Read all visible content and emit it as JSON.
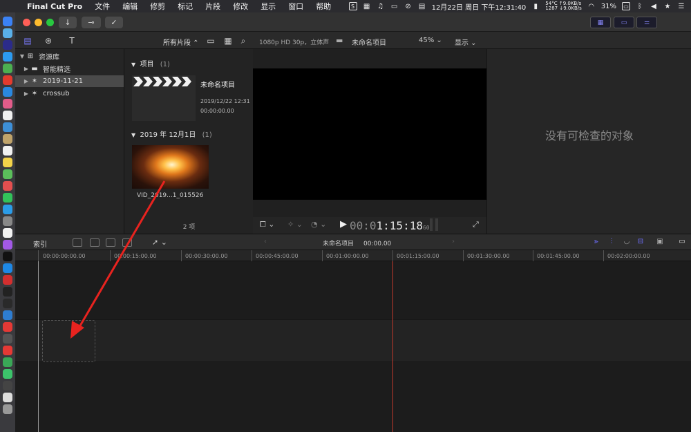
{
  "menubar": {
    "app_name": "Final Cut Pro",
    "items": [
      "文件",
      "编辑",
      "修剪",
      "标记",
      "片段",
      "修改",
      "显示",
      "窗口",
      "帮助"
    ],
    "temp": "54°C",
    "rpm": "1287",
    "net_up": "↑9.0KB/s",
    "net_down": "↓9.0KB/s",
    "datetime": "12月22日 周日 下午12:31:40",
    "battery": "31%"
  },
  "libraries": {
    "title": "资源库",
    "items": [
      "智能精选",
      "2019-11-21",
      "crossub"
    ]
  },
  "browser_toolbar": {
    "filter_label": "所有片段 ⌃"
  },
  "viewer_toolbar": {
    "format": "1080p HD 30p，立体声",
    "project": "未命名项目",
    "zoom": "45% ⌄",
    "display": "显示 ⌄"
  },
  "browser": {
    "projects_header": "项目",
    "projects_count": "(1)",
    "project_name": "未命名项目",
    "project_date": "2019/12/22 12:31",
    "project_duration": "00:00:00.00",
    "event_header": "2019 年 12月1日",
    "event_count": "(1)",
    "clip_name": "VID_2019...1_015526",
    "item_count": "2 项"
  },
  "viewer": {
    "timecode_dim": "00:0",
    "timecode_bright": "1:15:18",
    "timecode_frames": "60"
  },
  "inspector": {
    "empty_message": "没有可检查的对象"
  },
  "timeline_toolbar": {
    "index_label": "索引",
    "project": "未命名项目",
    "duration": "00:00.00"
  },
  "ruler": {
    "ticks": [
      "00:00:00:00.00",
      "00:00:15:00.00",
      "00:00:30:00.00",
      "00:00:45:00.00",
      "00:01:00:00.00",
      "00:01:15:00.00",
      "00:01:30:00.00",
      "00:01:45:00.00",
      "00:02:00:00.00"
    ]
  },
  "colors": {
    "accent": "#6f6fff",
    "playhead": "#c0392b",
    "arrow": "#e8231f"
  }
}
